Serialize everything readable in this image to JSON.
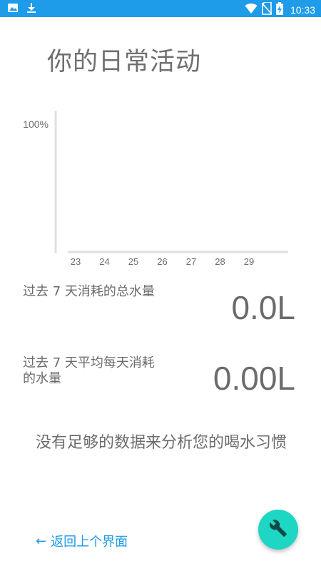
{
  "status_bar": {
    "time": "10:33",
    "left_icons": [
      "image-icon",
      "download-icon"
    ],
    "right_icons": [
      "wifi-icon",
      "no-sim-icon",
      "battery-charging-icon"
    ]
  },
  "page": {
    "title": "你的日常活动"
  },
  "chart_data": {
    "type": "bar",
    "categories": [
      "23",
      "24",
      "25",
      "26",
      "27",
      "28",
      "29"
    ],
    "values": [
      0,
      0,
      0,
      0,
      0,
      0,
      0
    ],
    "y_tick_labels": [
      "100%"
    ],
    "title": "",
    "xlabel": "",
    "ylabel": "",
    "ylim": [
      0,
      100
    ],
    "grid": false
  },
  "stats": {
    "total_label": "过去 7 天消耗的总水量",
    "total_value": "0.0L",
    "average_label_line1": "过去 7 天平均每天消耗",
    "average_label_line2": "的水量",
    "average_value": "0.00L"
  },
  "message": "没有足够的数据来分析您的喝水习惯",
  "back_link": {
    "arrow": "←",
    "label": "返回上个界面"
  },
  "fab": {
    "icon": "wrench-icon"
  },
  "colors": {
    "accent": "#1e9be9",
    "fab": "#1dd6c3",
    "text": "#6b6b6b",
    "axis": "#e0e0e0"
  }
}
